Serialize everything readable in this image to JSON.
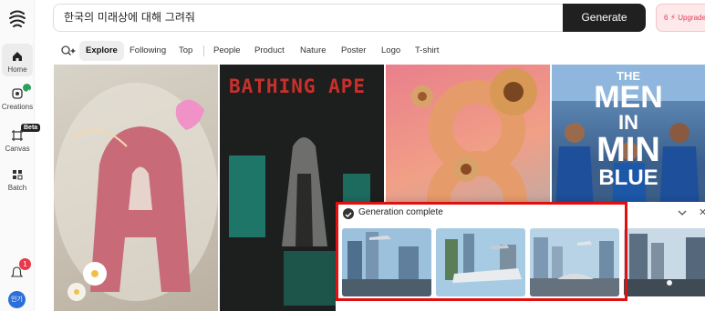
{
  "sidebar": {
    "items": [
      {
        "label": "Home",
        "icon": "home-icon"
      },
      {
        "label": "Creations",
        "icon": "creations-icon"
      },
      {
        "label": "Canvas",
        "icon": "canvas-icon",
        "badge": "Beta"
      },
      {
        "label": "Batch",
        "icon": "batch-icon"
      }
    ],
    "notifications_count": "1",
    "avatar_initials": "인기"
  },
  "prompt": {
    "value": "한국의 미래상에 대해 그려줘",
    "generate_label": "Generate",
    "upgrade_count": "6",
    "upgrade_label": "Upgrade"
  },
  "filters": {
    "tabs": [
      "Explore",
      "Following",
      "Top",
      "People",
      "Product",
      "Nature",
      "Poster",
      "Logo",
      "T-shirt"
    ],
    "active": "Explore"
  },
  "gallery": {
    "tile2_title": "BATHING APE",
    "tile4_text": [
      "THE",
      "MEN",
      "IN",
      "MIN",
      "BLUE"
    ]
  },
  "generation_panel": {
    "title": "Generation complete",
    "thumbnails": 4
  },
  "colors": {
    "accent_dark": "#202020",
    "upgrade_red": "#e43c55",
    "highlight_red": "#e01010",
    "creations_badge": "#2e9e5b"
  }
}
